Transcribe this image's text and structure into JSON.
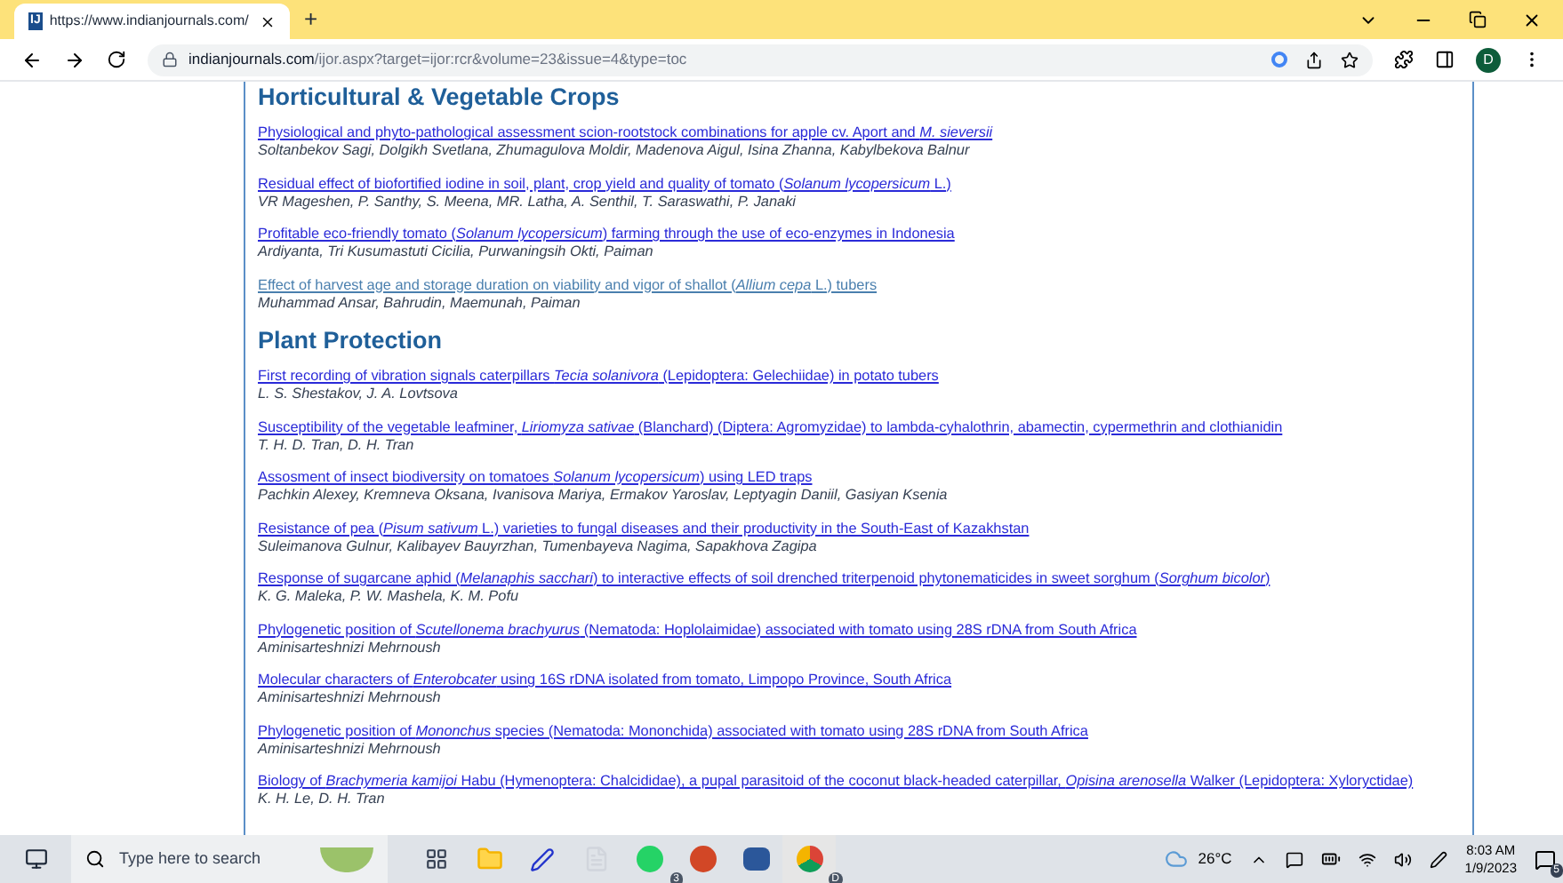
{
  "browser": {
    "tab": {
      "title": "https://www.indianjournals.com/",
      "favicon": "IJ",
      "selected": true
    },
    "new_tab": "+",
    "address": {
      "domain": "indianjournals.com",
      "path": "/ijor.aspx?target=ijor:rcr&volume=23&issue=4&type=toc"
    },
    "profile": "D"
  },
  "sections": [
    {
      "heading": "Horticultural & Vegetable Crops",
      "articles": [
        {
          "title": "Physiological and phyto-pathological assessment scion-rootstock combinations for apple cv. Aport and *M. sieversii*",
          "authors": "Soltanbekov Sagi, Dolgikh Svetlana, Zhumagulova Moldir, Madenova Aigul, Isina Zhanna, Kabylbekova Balnur",
          "visited": false
        },
        {
          "title": "Residual effect of biofortified iodine in soil, plant, crop yield and quality of tomato (*Solanum lycopersicum* L.)",
          "authors": "VR Mageshen, P. Santhy, S. Meena, MR. Latha, A. Senthil, T. Saraswathi, P. Janaki",
          "visited": false
        },
        {
          "title": "Profitable eco-friendly tomato (*Solanum lycopersicum*) farming through the use of eco-enzymes in Indonesia",
          "authors": "Ardiyanta, Tri Kusumastuti Cicilia, Purwaningsih Okti, Paiman",
          "visited": false
        },
        {
          "title": "Effect of harvest age and storage duration on viability and vigor of shallot (*Allium cepa* L.) tubers",
          "authors": "Muhammad Ansar, Bahrudin, Maemunah, Paiman",
          "visited": true
        }
      ]
    },
    {
      "heading": "Plant Protection",
      "articles": [
        {
          "title": "First recording of vibration signals caterpillars *Tecia solanivora* (Lepidoptera: Gelechiidae) in potato tubers",
          "authors": "L. S. Shestakov, J. A. Lovtsova",
          "visited": false
        },
        {
          "title": "Susceptibility of the vegetable leafminer, *Liriomyza sativae* (Blanchard) (Diptera: Agromyzidae) to lambda-cyhalothrin, abamectin, cypermethrin and clothianidin",
          "authors": "T. H. D. Tran, D. H. Tran",
          "visited": false
        },
        {
          "title": "Assosment of insect biodiversity on tomatoes *Solanum lycopersicum*) using LED traps",
          "authors": "Pachkin Alexey, Kremneva Oksana, Ivanisova Mariya, Ermakov Yaroslav, Leptyagin Daniil, Gasiyan Ksenia",
          "visited": false
        },
        {
          "title": "Resistance of pea (*Pisum sativum* L.) varieties to fungal diseases and their productivity in the South-East of Kazakhstan",
          "authors": "Suleimanova Gulnur, Kalibayev Bauyrzhan, Tumenbayeva Nagima, Sapakhova Zagipa",
          "visited": false
        },
        {
          "title": "Response of sugarcane aphid (*Melanaphis sacchari*) to interactive effects of soil drenched triterpenoid phytonematicides in sweet sorghum (*Sorghum bicolor*)",
          "authors": "K. G. Maleka, P. W. Mashela, K. M. Pofu",
          "visited": false
        },
        {
          "title": "Phylogenetic position of *Scutellonema brachyurus* (Nematoda: Hoplolaimidae) associated with tomato using 28S rDNA from South Africa",
          "authors": "Aminisarteshnizi Mehrnoush",
          "visited": false
        },
        {
          "title": "Molecular characters of *Enterobcater* using 16S rDNA isolated from tomato, Limpopo Province, South Africa",
          "authors": "Aminisarteshnizi Mehrnoush",
          "visited": false
        },
        {
          "title": "Phylogenetic position of *Mononchus* species (Nematoda: Mononchida) associated with tomato using 28S rDNA from South Africa",
          "authors": "Aminisarteshnizi Mehrnoush",
          "visited": false
        },
        {
          "title": "Biology of *Brachymeria kamijoi* Habu (Hymenoptera: Chalcididae), a pupal parasitoid of the coconut black-headed caterpillar, *Opisina arenosella* Walker (Lepidoptera: Xyloryctidae)",
          "authors": "K. H. Le, D. H. Tran",
          "visited": false
        }
      ]
    }
  ],
  "taskbar": {
    "search_placeholder": "Type here to search",
    "apps": [
      {
        "kind": "taskview"
      },
      {
        "kind": "files"
      },
      {
        "kind": "slash"
      },
      {
        "kind": "doc"
      },
      {
        "kind": "chat",
        "badge": "3"
      },
      {
        "kind": "slides"
      },
      {
        "kind": "word"
      },
      {
        "kind": "browser",
        "badge": "D"
      }
    ],
    "weather": "26°C",
    "time": "8:03 AM",
    "date": "1/9/2023",
    "notifications": "5"
  }
}
